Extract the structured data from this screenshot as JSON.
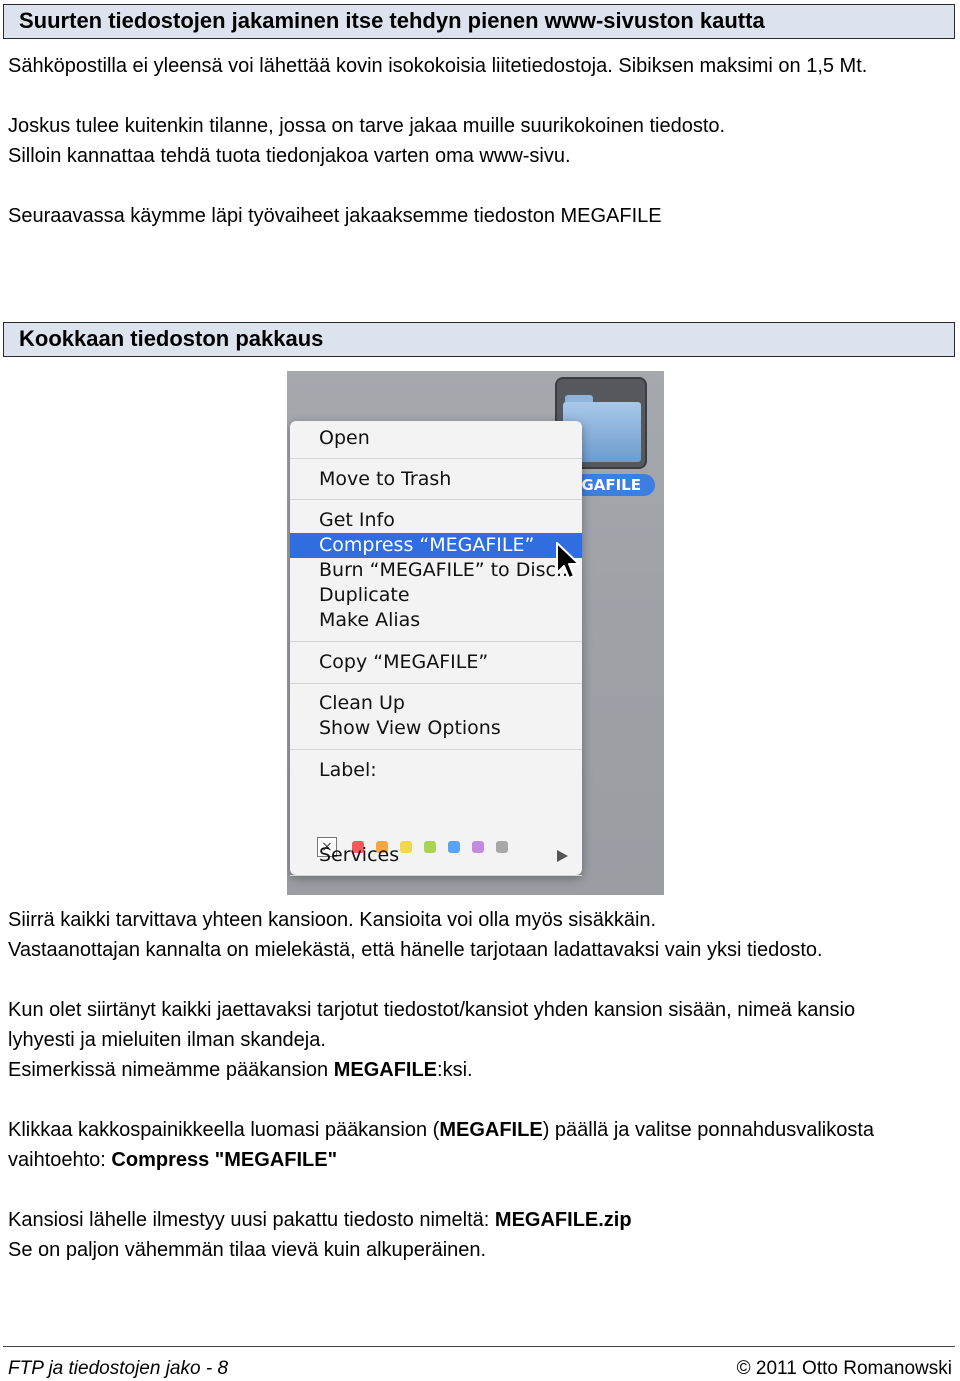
{
  "heading1": "Suurten tiedostojen jakaminen itse tehdyn pienen www-sivuston kautta",
  "intro": [
    "Sähköpostilla ei yleensä voi lähettää kovin isokokoisia liitetiedostoja. Sibiksen maksimi on 1,5 Mt.",
    "Joskus tulee kuitenkin tilanne, jossa on tarve jakaa muille suurikokoinen tiedosto.",
    "Silloin kannattaa tehdä tuota tiedonjakoa varten oma www-sivu.",
    "Seuraavassa käymme läpi työvaiheet jakaaksemme tiedoston MEGAFILE"
  ],
  "heading2": "Kookkaan tiedoston pakkaus",
  "screenshot": {
    "folder_label": "EGAFILE",
    "menu_items": {
      "open": "Open",
      "trash": "Move to Trash",
      "get_info": "Get Info",
      "compress": "Compress “MEGAFILE”",
      "burn": "Burn “MEGAFILE” to Disc...",
      "duplicate": "Duplicate",
      "alias": "Make Alias",
      "copy": "Copy “MEGAFILE”",
      "clean_up": "Clean Up",
      "view_options": "Show View Options",
      "label": "Label:",
      "label_x": "×",
      "services": "Services"
    },
    "label_colors": [
      "#f25a55",
      "#f6a640",
      "#f2d64b",
      "#a7d552",
      "#5aa3f1",
      "#c48ae0",
      "#a8a8a8"
    ],
    "selection_color": "#2f6de1"
  },
  "body": {
    "p1a": "Siirrä kaikki tarvittava yhteen kansioon. Kansioita voi olla myös sisäkkäin.",
    "p1b": "Vastaanottajan kannalta on mielekästä, että hänelle tarjotaan ladattavaksi vain yksi tiedosto.",
    "p2a": "Kun olet siirtänyt kaikki jaettavaksi tarjotut tiedostot/kansiot yhden kansion sisään, nimeä kansio",
    "p2b": "lyhyesti ja mieluiten ilman skandeja.",
    "p2c_pre": "Esimerkissä nimeämme pääkansion ",
    "p2c_bold": "MEGAFILE",
    "p2c_post": ":ksi.",
    "p3a_pre": "Klikkaa kakkospainikkeella luomasi pääkansion (",
    "p3a_bold": "MEGAFILE",
    "p3a_post": ") päällä ja valitse ponnahdusvalikosta",
    "p3b_pre": "vaihtoehto: ",
    "p3b_bold": "Compress \"MEGAFILE\"",
    "p4a_pre": "Kansiosi lähelle ilmestyy uusi pakattu tiedosto nimeltä: ",
    "p4a_bold": "MEGAFILE.zip",
    "p4b": "Se on paljon vähemmän tilaa vievä kuin alkuperäinen."
  },
  "footer": {
    "left": "FTP ja tiedostojen jako - 8",
    "right": "© 2011 Otto Romanowski"
  }
}
